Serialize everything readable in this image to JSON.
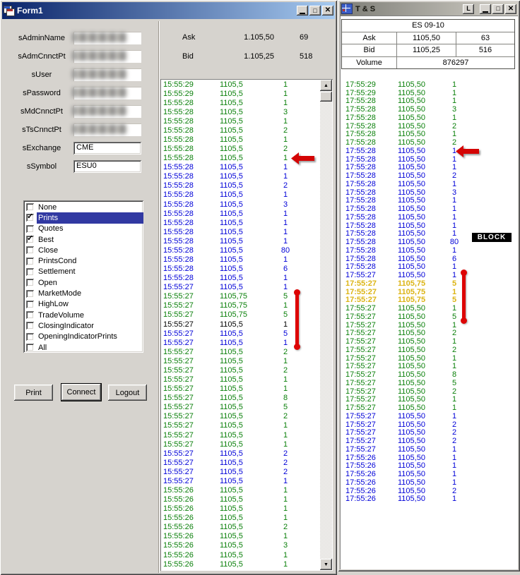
{
  "colors": {
    "green": "#0b800b",
    "blue": "#0000d8",
    "yellow": "#dcb414",
    "black": "#000000",
    "red": "#dd0404",
    "highlight": "#3139a2"
  },
  "icons": {
    "maximize": "□",
    "close": "✕",
    "lock": "L",
    "scroll_up": "▲",
    "scroll_down": "▼"
  },
  "left_window": {
    "title": "Form1",
    "fields": [
      {
        "label": "sAdminName",
        "cls": "masked"
      },
      {
        "label": "sAdmCnnctPt",
        "cls": "masked"
      },
      {
        "label": "sUser",
        "cls": "masked"
      },
      {
        "label": "sPassword",
        "cls": "masked"
      },
      {
        "label": "sMdCnnctPt",
        "cls": "masked"
      },
      {
        "label": "sTsCnnctPt",
        "cls": "masked"
      },
      {
        "label": "sExchange",
        "value": "CME",
        "cls": "plain"
      },
      {
        "label": "sSymbol",
        "value": "ESU0",
        "cls": "plain"
      }
    ],
    "options": [
      {
        "label": "None",
        "checked": false
      },
      {
        "label": "Prints",
        "checked": true,
        "cls": "sel"
      },
      {
        "label": "Quotes",
        "checked": false
      },
      {
        "label": "Best",
        "checked": true
      },
      {
        "label": "Close",
        "checked": false
      },
      {
        "label": "PrintsCond",
        "checked": false
      },
      {
        "label": "Settlement",
        "checked": false
      },
      {
        "label": "Open",
        "checked": false
      },
      {
        "label": "MarketMode",
        "checked": false
      },
      {
        "label": "HighLow",
        "checked": false
      },
      {
        "label": "TradeVolume",
        "checked": false
      },
      {
        "label": "ClosingIndicator",
        "checked": false
      },
      {
        "label": "OpeningIndicatorPrints",
        "checked": false
      },
      {
        "label": "All",
        "checked": false
      }
    ],
    "buttons": {
      "print": "Print",
      "connect": "Connect",
      "logout": "Logout"
    }
  },
  "mid_panel": {
    "quote": {
      "ask_label": "Ask",
      "ask_price": "1.105,50",
      "ask_size": "69",
      "bid_label": "Bid",
      "bid_price": "1.105,25",
      "bid_size": "518"
    },
    "rows": [
      [
        "15:55:29",
        "1105,5",
        "1",
        "g"
      ],
      [
        "15:55:29",
        "1105,5",
        "1",
        "g"
      ],
      [
        "15:55:28",
        "1105,5",
        "1",
        "g"
      ],
      [
        "15:55:28",
        "1105,5",
        "3",
        "g"
      ],
      [
        "15:55:28",
        "1105,5",
        "1",
        "g"
      ],
      [
        "15:55:28",
        "1105,5",
        "2",
        "g"
      ],
      [
        "15:55:28",
        "1105,5",
        "1",
        "g"
      ],
      [
        "15:55:28",
        "1105,5",
        "2",
        "g"
      ],
      [
        "15:55:28",
        "1105,5",
        "1",
        "g"
      ],
      [
        "15:55:28",
        "1105,5",
        "1",
        "b"
      ],
      [
        "15:55:28",
        "1105,5",
        "1",
        "b"
      ],
      [
        "15:55:28",
        "1105,5",
        "2",
        "b"
      ],
      [
        "15:55:28",
        "1105,5",
        "1",
        "b"
      ],
      [
        "15:55:28",
        "1105,5",
        "3",
        "b"
      ],
      [
        "15:55:28",
        "1105,5",
        "1",
        "b"
      ],
      [
        "15:55:28",
        "1105,5",
        "1",
        "b"
      ],
      [
        "15:55:28",
        "1105,5",
        "1",
        "b"
      ],
      [
        "15:55:28",
        "1105,5",
        "1",
        "b"
      ],
      [
        "15:55:28",
        "1105,5",
        "80",
        "b"
      ],
      [
        "15:55:28",
        "1105,5",
        "1",
        "b"
      ],
      [
        "15:55:28",
        "1105,5",
        "6",
        "b"
      ],
      [
        "15:55:28",
        "1105,5",
        "1",
        "b"
      ],
      [
        "15:55:27",
        "1105,5",
        "1",
        "b"
      ],
      [
        "15:55:27",
        "1105,75",
        "5",
        "g"
      ],
      [
        "15:55:27",
        "1105,75",
        "1",
        "g"
      ],
      [
        "15:55:27",
        "1105,75",
        "5",
        "g"
      ],
      [
        "15:55:27",
        "1105,5",
        "1",
        "k"
      ],
      [
        "15:55:27",
        "1105,5",
        "5",
        "b"
      ],
      [
        "15:55:27",
        "1105,5",
        "1",
        "b"
      ],
      [
        "15:55:27",
        "1105,5",
        "2",
        "g"
      ],
      [
        "15:55:27",
        "1105,5",
        "1",
        "g"
      ],
      [
        "15:55:27",
        "1105,5",
        "2",
        "g"
      ],
      [
        "15:55:27",
        "1105,5",
        "1",
        "g"
      ],
      [
        "15:55:27",
        "1105,5",
        "1",
        "g"
      ],
      [
        "15:55:27",
        "1105,5",
        "8",
        "g"
      ],
      [
        "15:55:27",
        "1105,5",
        "5",
        "g"
      ],
      [
        "15:55:27",
        "1105,5",
        "2",
        "g"
      ],
      [
        "15:55:27",
        "1105,5",
        "1",
        "g"
      ],
      [
        "15:55:27",
        "1105,5",
        "1",
        "g"
      ],
      [
        "15:55:27",
        "1105,5",
        "1",
        "g"
      ],
      [
        "15:55:27",
        "1105,5",
        "2",
        "b"
      ],
      [
        "15:55:27",
        "1105,5",
        "2",
        "b"
      ],
      [
        "15:55:27",
        "1105,5",
        "2",
        "b"
      ],
      [
        "15:55:27",
        "1105,5",
        "1",
        "b"
      ],
      [
        "15:55:26",
        "1105,5",
        "1",
        "g"
      ],
      [
        "15:55:26",
        "1105,5",
        "1",
        "g"
      ],
      [
        "15:55:26",
        "1105,5",
        "1",
        "g"
      ],
      [
        "15:55:26",
        "1105,5",
        "1",
        "g"
      ],
      [
        "15:55:26",
        "1105,5",
        "2",
        "g"
      ],
      [
        "15:55:26",
        "1105,5",
        "1",
        "g"
      ],
      [
        "15:55:26",
        "1105,5",
        "3",
        "g"
      ],
      [
        "15:55:26",
        "1105,5",
        "1",
        "g"
      ],
      [
        "15:55:26",
        "1105,5",
        "1",
        "g"
      ]
    ]
  },
  "right_window": {
    "title": "T & S",
    "table": {
      "symbol": "ES 09-10",
      "ask_label": "Ask",
      "ask_price": "1105,50",
      "ask_size": "63",
      "bid_label": "Bid",
      "bid_price": "1105,25",
      "bid_size": "516",
      "volume_label": "Volume",
      "volume": "876297"
    },
    "rows": [
      [
        "17:55:29",
        "1105,50",
        "1",
        "g"
      ],
      [
        "17:55:29",
        "1105,50",
        "1",
        "g"
      ],
      [
        "17:55:28",
        "1105,50",
        "1",
        "g"
      ],
      [
        "17:55:28",
        "1105,50",
        "3",
        "g"
      ],
      [
        "17:55:28",
        "1105,50",
        "1",
        "g"
      ],
      [
        "17:55:28",
        "1105,50",
        "2",
        "g"
      ],
      [
        "17:55:28",
        "1105,50",
        "1",
        "g"
      ],
      [
        "17:55:28",
        "1105,50",
        "2",
        "g"
      ],
      [
        "17:55:28",
        "1105,50",
        "1",
        "b"
      ],
      [
        "17:55:28",
        "1105,50",
        "1",
        "b"
      ],
      [
        "17:55:28",
        "1105,50",
        "1",
        "b"
      ],
      [
        "17:55:28",
        "1105,50",
        "2",
        "b"
      ],
      [
        "17:55:28",
        "1105,50",
        "1",
        "b"
      ],
      [
        "17:55:28",
        "1105,50",
        "3",
        "b"
      ],
      [
        "17:55:28",
        "1105,50",
        "1",
        "b"
      ],
      [
        "17:55:28",
        "1105,50",
        "1",
        "b"
      ],
      [
        "17:55:28",
        "1105,50",
        "1",
        "b"
      ],
      [
        "17:55:28",
        "1105,50",
        "1",
        "b"
      ],
      [
        "17:55:28",
        "1105,50",
        "1",
        "b"
      ],
      [
        "17:55:28",
        "1105,50",
        "80",
        "b"
      ],
      [
        "17:55:28",
        "1105,50",
        "1",
        "b"
      ],
      [
        "17:55:28",
        "1105,50",
        "6",
        "b"
      ],
      [
        "17:55:28",
        "1105,50",
        "1",
        "b"
      ],
      [
        "17:55:27",
        "1105,50",
        "1",
        "b"
      ],
      [
        "17:55:27",
        "1105,75",
        "5",
        "y"
      ],
      [
        "17:55:27",
        "1105,75",
        "1",
        "y"
      ],
      [
        "17:55:27",
        "1105,75",
        "5",
        "y"
      ],
      [
        "17:55:27",
        "1105,50",
        "1",
        "g"
      ],
      [
        "17:55:27",
        "1105,50",
        "5",
        "g"
      ],
      [
        "17:55:27",
        "1105,50",
        "1",
        "g"
      ],
      [
        "17:55:27",
        "1105,50",
        "2",
        "g"
      ],
      [
        "17:55:27",
        "1105,50",
        "1",
        "g"
      ],
      [
        "17:55:27",
        "1105,50",
        "2",
        "g"
      ],
      [
        "17:55:27",
        "1105,50",
        "1",
        "g"
      ],
      [
        "17:55:27",
        "1105,50",
        "1",
        "g"
      ],
      [
        "17:55:27",
        "1105,50",
        "8",
        "g"
      ],
      [
        "17:55:27",
        "1105,50",
        "5",
        "g"
      ],
      [
        "17:55:27",
        "1105,50",
        "2",
        "g"
      ],
      [
        "17:55:27",
        "1105,50",
        "1",
        "g"
      ],
      [
        "17:55:27",
        "1105,50",
        "1",
        "g"
      ],
      [
        "17:55:27",
        "1105,50",
        "1",
        "b"
      ],
      [
        "17:55:27",
        "1105,50",
        "2",
        "b"
      ],
      [
        "17:55:27",
        "1105,50",
        "2",
        "b"
      ],
      [
        "17:55:27",
        "1105,50",
        "2",
        "b"
      ],
      [
        "17:55:27",
        "1105,50",
        "1",
        "b"
      ],
      [
        "17:55:26",
        "1105,50",
        "1",
        "b"
      ],
      [
        "17:55:26",
        "1105,50",
        "1",
        "b"
      ],
      [
        "17:55:26",
        "1105,50",
        "1",
        "b"
      ],
      [
        "17:55:26",
        "1105,50",
        "1",
        "b"
      ],
      [
        "17:55:26",
        "1105,50",
        "2",
        "b"
      ],
      [
        "17:55:26",
        "1105,50",
        "1",
        "b"
      ]
    ]
  },
  "annotations": {
    "block_label": "BLOCK"
  }
}
